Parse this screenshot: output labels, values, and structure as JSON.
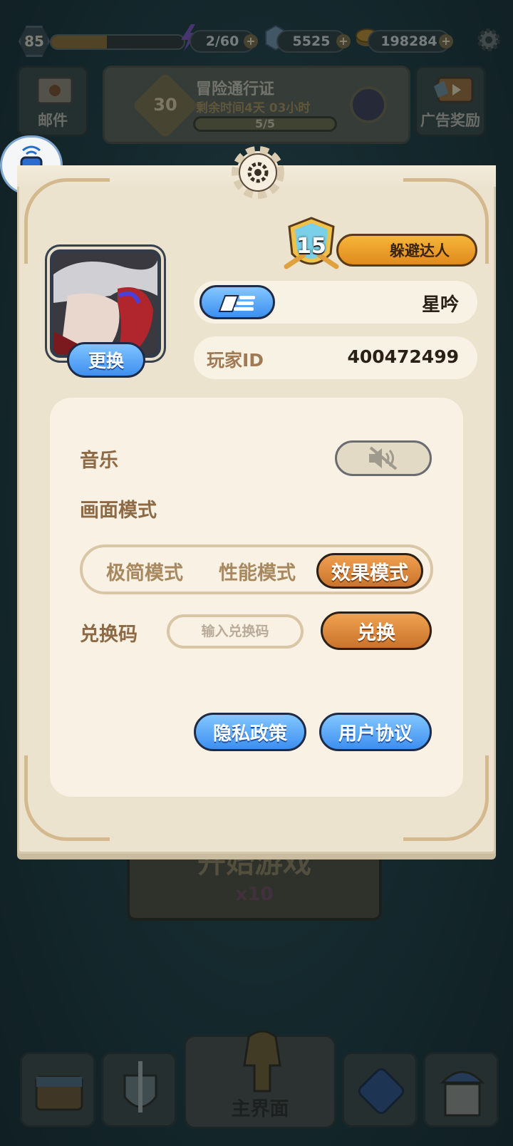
{
  "topbar": {
    "level": "85",
    "energy": "2/60",
    "gems": "5525",
    "coins": "198284",
    "plus": "+"
  },
  "side_buttons": {
    "mail": "邮件",
    "ad_reward": "广告奖励"
  },
  "pass": {
    "title": "冒险通行证",
    "remaining": "剩余时间4天 03小时",
    "level": "30",
    "progress_text": "5/5",
    "progress_fraction": 1.0
  },
  "profile": {
    "rank_level": "15",
    "rank_title": "躲避达人",
    "change_label": "更换",
    "player_name": "星吟",
    "id_label": "玩家ID",
    "id_value": "400472499"
  },
  "settings": {
    "music_label": "音乐",
    "music_muted": true,
    "display_mode_label": "画面模式",
    "modes": [
      "极简模式",
      "性能模式",
      "效果模式"
    ],
    "active_mode": "效果模式",
    "redeem_label": "兑换码",
    "redeem_placeholder": "输入兑换码",
    "redeem_button": "兑换",
    "privacy_button": "隐私政策",
    "agreement_button": "用户协议"
  },
  "background": {
    "start_label": "开始游戏",
    "start_cost": "x10",
    "main_tab": "主界面"
  },
  "colors": {
    "panel": "#ece3cf",
    "accent_orange": "#e08a1c",
    "accent_blue": "#3c8ff0",
    "label_brown": "#8d6a45"
  }
}
